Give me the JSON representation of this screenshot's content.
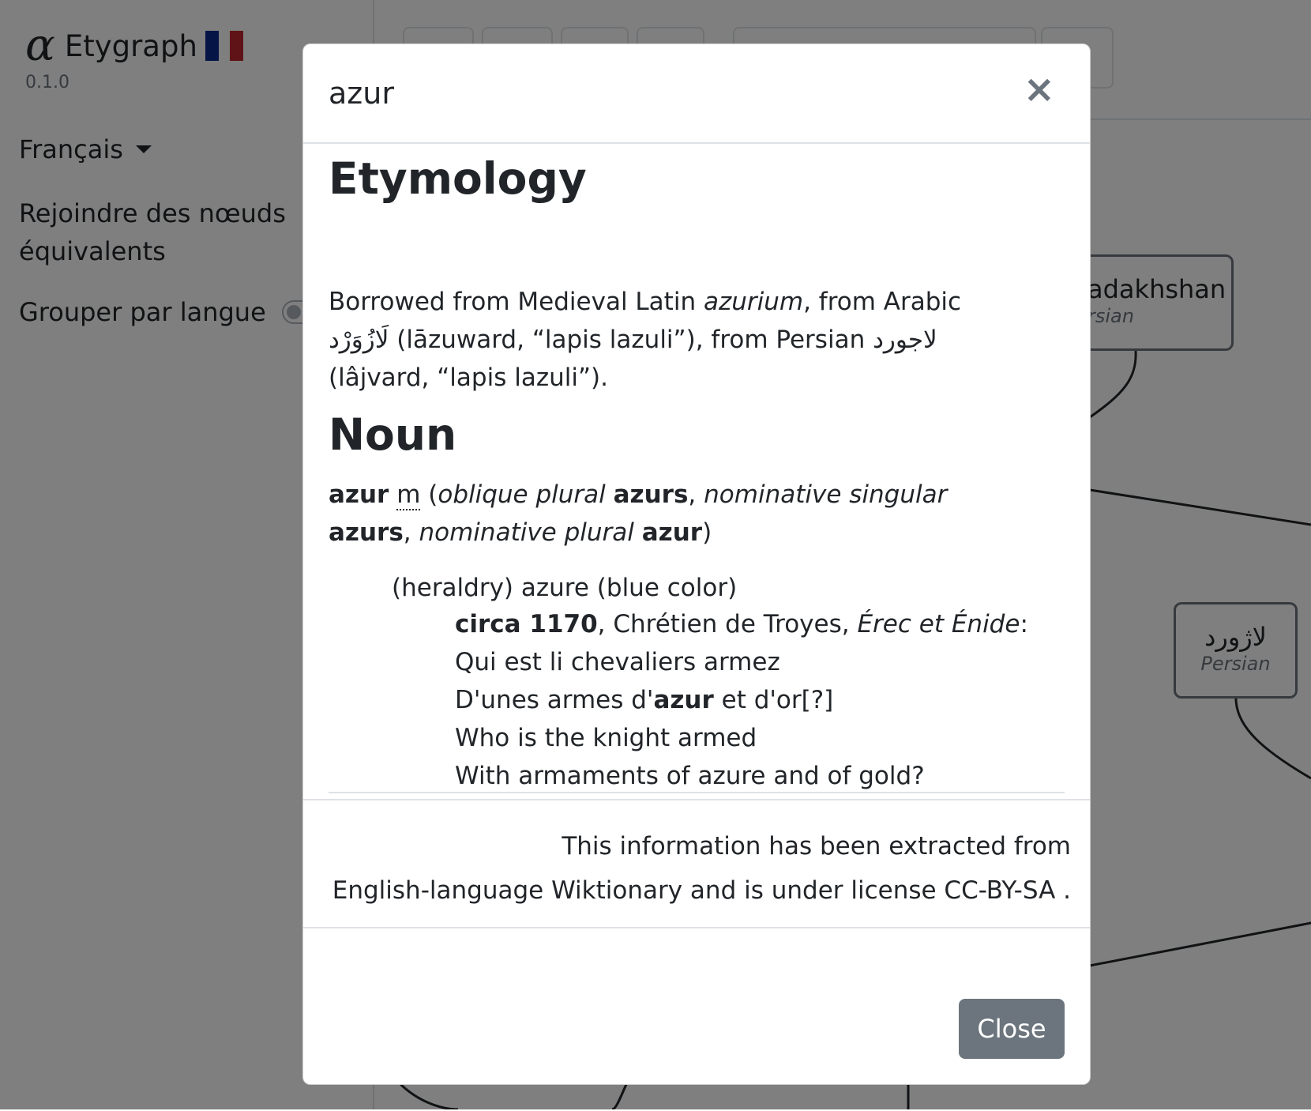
{
  "app": {
    "logo_glyph": "α",
    "name": "Etygraph",
    "version": "0.1.0",
    "language_select": "Français",
    "join_nodes_label": "Rejoindre des nœuds équivalents",
    "group_by_language_label": "Grouper par langue",
    "group_by_language_on": false,
    "flag_colors": [
      "#0a2a8c",
      "#ffffff",
      "#c1272d"
    ]
  },
  "graph": {
    "nodes": [
      {
        "word": "adakhshan",
        "lang": "rsian"
      },
      {
        "word": "لاژورد",
        "lang": "Persian"
      }
    ]
  },
  "modal": {
    "title": "azur",
    "close_icon": "×",
    "etymology_heading": "Etymology",
    "etymology": {
      "t1": "Borrowed from Medieval Latin ",
      "latin_term": "azurium",
      "t2": ", from Arabic ",
      "arabic_term": "لَازُوَرْد",
      "t3": " (lāzuward, “lapis lazuli”), from Persian ",
      "persian_term": "لاجورد",
      "t4": " (lâjvard, “lapis lazuli”)."
    },
    "noun_heading": "Noun",
    "headword": {
      "word": "azur",
      "gender": "m",
      "open_paren": "(",
      "f1_label": "oblique plural",
      "f1_value": "azurs",
      "f2_label": "nominative singular",
      "f2_value": "azurs",
      "f3_label": "nominative plural",
      "f3_value": "azur",
      "close_paren": ")"
    },
    "sense": "(heraldry) azure (blue color)",
    "quote": {
      "date": "circa 1170",
      "author": ", Chrétien de Troyes, ",
      "work": "Érec et Énide",
      "colon": ":",
      "line1": "Qui est li chevaliers armez",
      "line2_a": "D'unes armes d'",
      "line2_b": "azur",
      "line2_c": " et d'or[?]",
      "line3": "Who is the knight armed",
      "line4": "With armaments of azure and of gold?"
    },
    "notice_line1": "This information has been extracted from",
    "notice_line2": "English-language Wiktionary and is under license CC-BY-SA .",
    "close_button": "Close"
  },
  "colors": {
    "backdrop": "rgba(0,0,0,0.5)",
    "close_button_bg": "#6c757d",
    "text": "#212529"
  }
}
